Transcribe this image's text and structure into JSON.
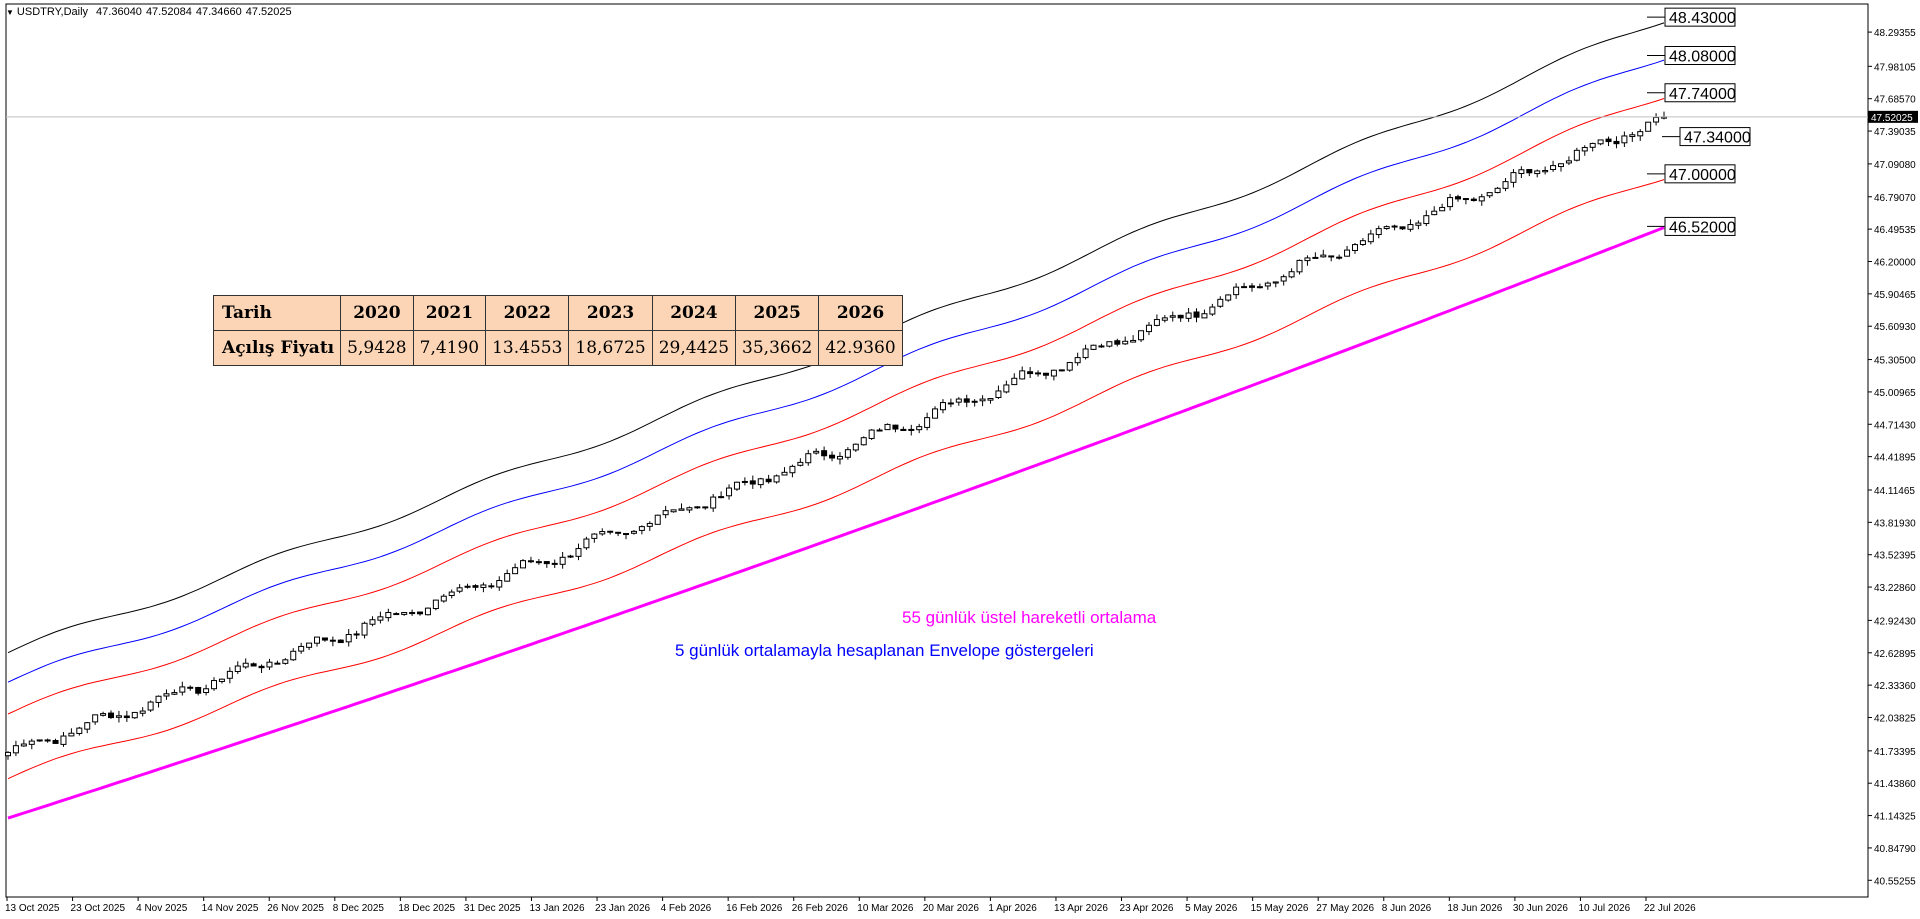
{
  "header": {
    "symbol": "USDTRY,Daily",
    "open": "47.36040",
    "high": "47.52084",
    "low": "47.34660",
    "close": "47.52025"
  },
  "colors": {
    "candle_up_fill": "#ffffff",
    "candle_down_fill": "#000000",
    "outer_envelope": "#000000",
    "mid_envelope": "#0000ff",
    "inner_envelope": "#ff0000",
    "ema55": "#ff00ff",
    "table_bg": "#fbd5b5",
    "ann_ema": "#ff00ff",
    "ann_env": "#0000ff"
  },
  "table": {
    "head": "Tarih",
    "row_label": "Açılış Fiyatı",
    "years": [
      "2020",
      "2021",
      "2022",
      "2023",
      "2024",
      "2025",
      "2026"
    ],
    "values": [
      "5,9428",
      "7,4190",
      "13.4553",
      "18,6725",
      "29,4425",
      "35,3662",
      "42.9360"
    ]
  },
  "annotations": {
    "ema": "55 günlük üstel hareketli ortalama",
    "envelope": "5 günlük ortalamayla hesaplanan Envelope göstergeleri"
  },
  "chart_data": {
    "type": "candlestick",
    "price_axis_ticks": [
      "48.29355",
      "47.98105",
      "47.68570",
      "47.39035",
      "47.09080",
      "46.79070",
      "46.49535",
      "46.20000",
      "45.90465",
      "45.60930",
      "45.30500",
      "45.00965",
      "44.71430",
      "44.41895",
      "44.11465",
      "43.81930",
      "43.52395",
      "43.22860",
      "42.92430",
      "42.62895",
      "42.33360",
      "42.03825",
      "41.73395",
      "41.43860",
      "41.14325",
      "40.84790",
      "40.55255"
    ],
    "date_axis_ticks": [
      "13 Oct 2025",
      "23 Oct 2025",
      "4 Nov 2025",
      "14 Nov 2025",
      "26 Nov 2025",
      "8 Dec 2025",
      "18 Dec 2025",
      "31 Dec 2025",
      "13 Jan 2026",
      "23 Jan 2026",
      "4 Feb 2026",
      "16 Feb 2026",
      "26 Feb 2026",
      "10 Mar 2026",
      "20 Mar 2026",
      "1 Apr 2026",
      "13 Apr 2026",
      "23 Apr 2026",
      "5 May 2026",
      "15 May 2026",
      "27 May 2026",
      "8 Jun 2026",
      "18 Jun 2026",
      "30 Jun 2026",
      "10 Jul 2026",
      "22 Jul 2026"
    ],
    "ylim": [
      40.4,
      48.55
    ],
    "current_price": "47.52025",
    "level_labels": [
      "48.43000",
      "48.08000",
      "47.74000",
      "47.34000",
      "47.00000",
      "46.52000"
    ],
    "series": [
      {
        "name": "Outer envelope",
        "start": 42.63,
        "end": 48.41
      },
      {
        "name": "Middle envelope",
        "start": 42.36,
        "end": 48.07
      },
      {
        "name": "Inner envelope",
        "start": 42.07,
        "end": 47.72
      },
      {
        "name": "Lower envelope",
        "start": 41.48,
        "end": 46.98
      },
      {
        "name": "EMA 55",
        "start": 41.12,
        "end": 46.51
      }
    ],
    "candles": {
      "count": 210,
      "first_close": 41.72,
      "last_close": 47.52
    }
  }
}
